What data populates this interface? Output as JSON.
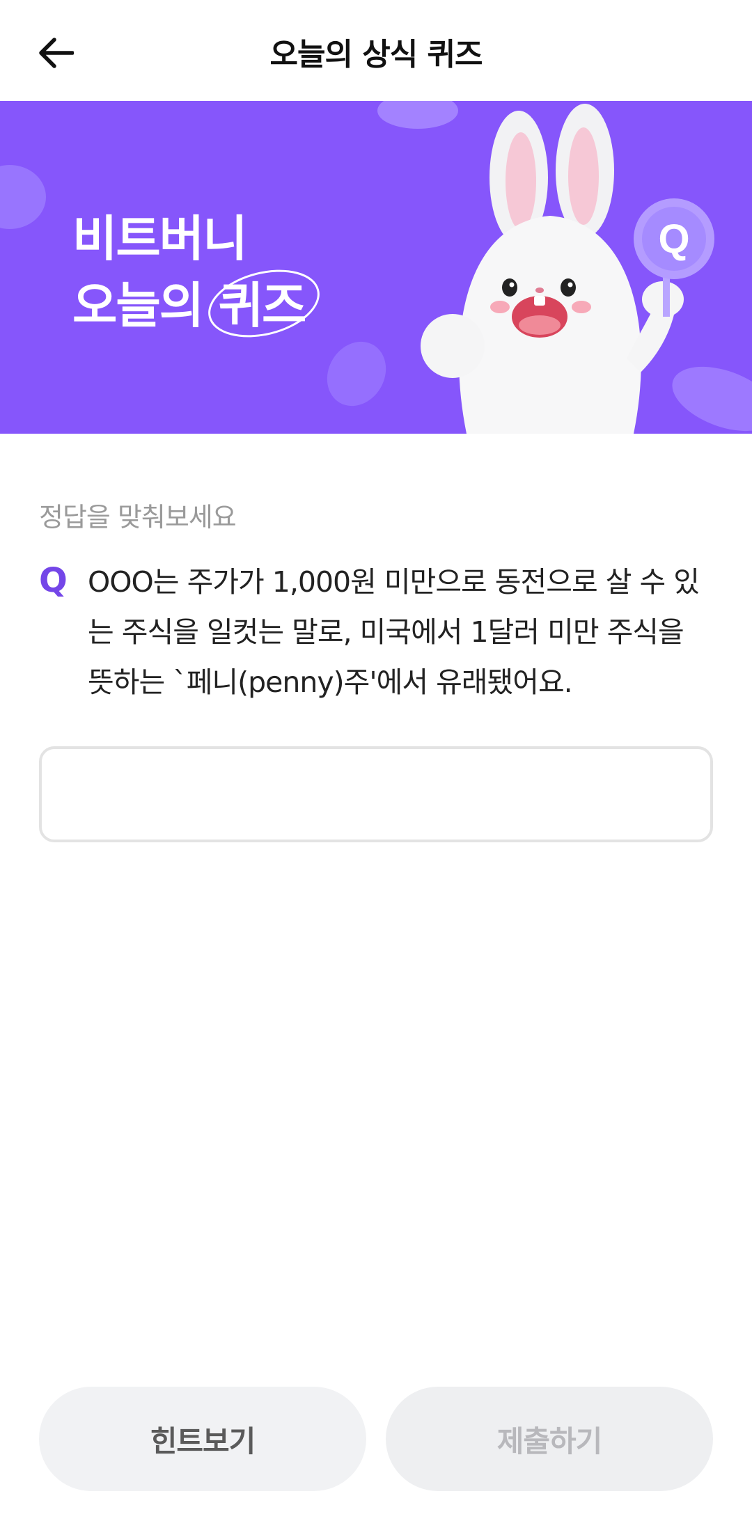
{
  "header": {
    "title": "오늘의 상식 퀴즈"
  },
  "banner": {
    "line1": "비트버니",
    "line2_prefix": "오늘의 ",
    "line2_circled": "퀴즈",
    "badge_letter": "Q",
    "background_color": "#8656fb"
  },
  "quiz": {
    "prompt": "정답을 맞춰보세요",
    "q_label": "Q",
    "question": "OOO는 주가가 1,000원 미만으로 동전으로 살 수 있는 주식을 일컷는 말로, 미국에서 1달러 미만 주식을 뜻하는 `페니(penny)주'에서 유래됐어요.",
    "answer_value": "",
    "answer_placeholder": ""
  },
  "buttons": {
    "hint_label": "힌트보기",
    "submit_label": "제출하기"
  },
  "colors": {
    "accent": "#7446e8",
    "button_bg": "#f1f2f4"
  }
}
